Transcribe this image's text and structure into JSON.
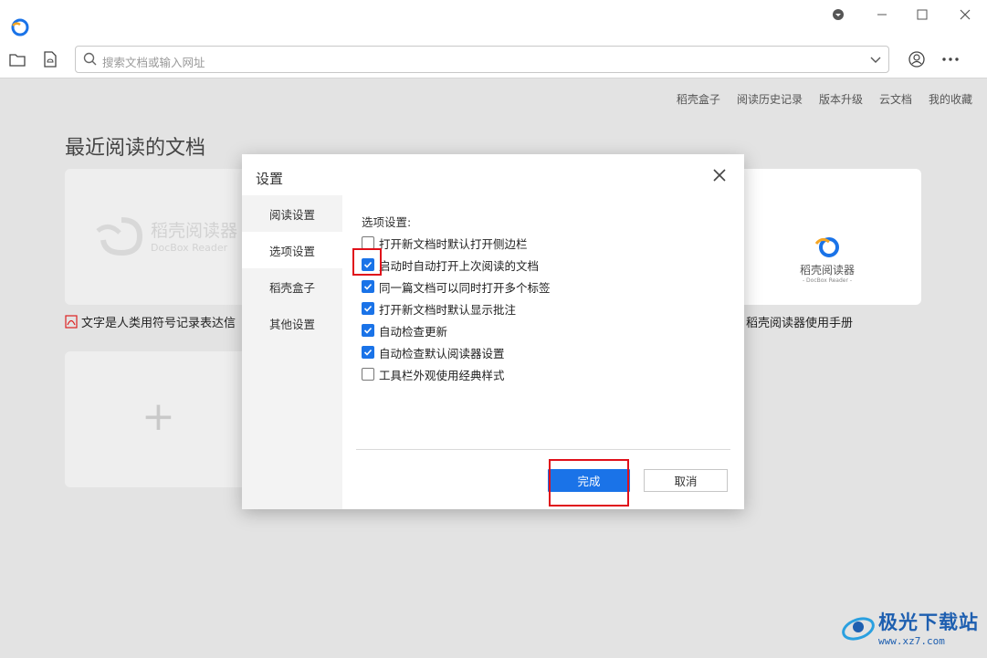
{
  "app": {
    "accent": "#1a73e8",
    "highlight": "#e0101a"
  },
  "toolbar": {
    "search_placeholder": "搜索文档或输入网址"
  },
  "top_links": [
    "稻壳盒子",
    "阅读历史记录",
    "版本升级",
    "云文档",
    "我的收藏"
  ],
  "main": {
    "section_title": "最近阅读的文档",
    "cards": [
      {
        "logo_text": "稻壳阅读器",
        "logo_sub": "DocBox Reader",
        "caption": "文字是人类用符号记录表达信"
      },
      {
        "logo_text": "稻壳阅读器",
        "logo_sub": "- DocBox Reader -",
        "caption": "稻壳阅读器使用手册"
      }
    ],
    "add_card_symbol": "+"
  },
  "dialog": {
    "title": "设置",
    "sidebar": [
      "阅读设置",
      "选项设置",
      "稻壳盒子",
      "其他设置"
    ],
    "active_tab": "选项设置",
    "options_heading": "选项设置:",
    "options": [
      {
        "label": "打开新文档时默认打开侧边栏",
        "checked": false
      },
      {
        "label": "启动时自动打开上次阅读的文档",
        "checked": true
      },
      {
        "label": "同一篇文档可以同时打开多个标签",
        "checked": true
      },
      {
        "label": "打开新文档时默认显示批注",
        "checked": true
      },
      {
        "label": "自动检查更新",
        "checked": true
      },
      {
        "label": "自动检查默认阅读器设置",
        "checked": true
      },
      {
        "label": "工具栏外观使用经典样式",
        "checked": false
      }
    ],
    "confirm_label": "完成",
    "cancel_label": "取消"
  },
  "watermark": {
    "title": "极光下载站",
    "url": "www.xz7.com"
  }
}
